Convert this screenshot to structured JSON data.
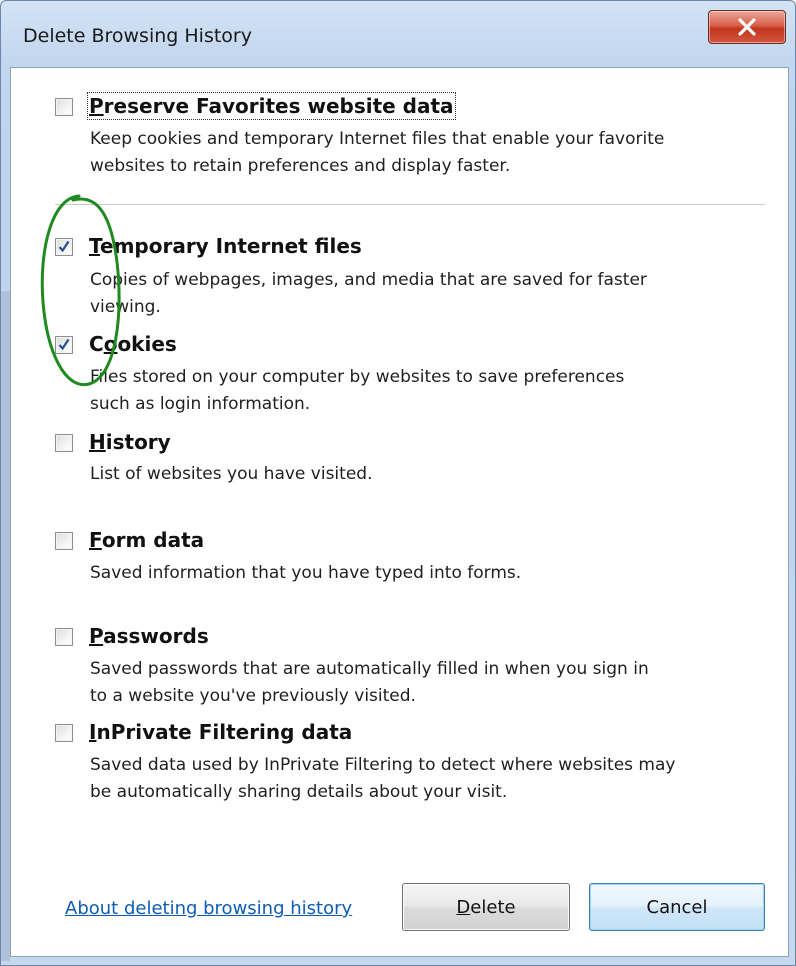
{
  "window": {
    "title": "Delete Browsing History",
    "close_icon": "close-icon"
  },
  "options": [
    {
      "key": "P",
      "rest": "reserve Favorites website data",
      "checked": false,
      "description": [
        "Keep cookies and temporary Internet files that enable your favorite",
        "websites to retain preferences and display faster."
      ]
    },
    {
      "key": "T",
      "rest": "emporary Internet files",
      "checked": true,
      "description": [
        "Copies of webpages, images, and media that are saved for faster",
        "viewing."
      ]
    },
    {
      "key": "o",
      "pre": "C",
      "rest": "okies",
      "checked": true,
      "description": [
        "Files stored on your computer by websites to save preferences",
        "such as login information."
      ]
    },
    {
      "key": "H",
      "rest": "istory",
      "checked": false,
      "description": [
        "List of websites you have visited."
      ]
    },
    {
      "key": "F",
      "rest": "orm data",
      "checked": false,
      "description": [
        "Saved information that you have typed into forms."
      ]
    },
    {
      "key": "P",
      "rest": "asswords",
      "checked": false,
      "description": [
        "Saved passwords that are automatically filled in when you sign in",
        "to a website you've previously visited."
      ]
    },
    {
      "key": "I",
      "rest": "nPrivate Filtering data",
      "checked": false,
      "description": [
        "Saved data used by InPrivate Filtering to detect where websites may",
        "be automatically sharing details about your visit."
      ]
    }
  ],
  "footer": {
    "link": "About deleting browsing history",
    "delete": {
      "key": "D",
      "rest": "elete"
    },
    "cancel": "Cancel"
  },
  "colors": {
    "link": "#0f5bb5",
    "annotation_circle": "#1f8a1f",
    "checkmark": "#2a4f8f"
  }
}
